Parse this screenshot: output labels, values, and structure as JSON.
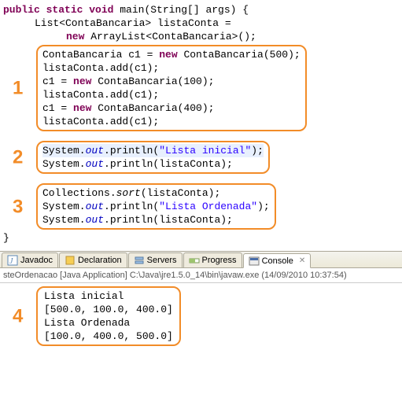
{
  "code": {
    "main_sig_pre": "public static void",
    "main_sig_post": " main(String[] args) {",
    "decl1": "List<ContaBancaria> listaConta =",
    "decl2_pre": "new",
    "decl2_post": " ArrayList<ContaBancaria>();",
    "block1": {
      "num": "1",
      "l1a": "ContaBancaria c1 = ",
      "l1b": "new",
      "l1c": " ContaBancaria(500);",
      "l2": "listaConta.add(c1);",
      "l3a": "c1 = ",
      "l3b": "new",
      "l3c": " ContaBancaria(100);",
      "l4": "listaConta.add(c1);",
      "l5a": "c1 = ",
      "l5b": "new",
      "l5c": " ContaBancaria(400);",
      "l6": "listaConta.add(c1);"
    },
    "block2": {
      "num": "2",
      "l1a": "System.",
      "l1b": "out",
      "l1c": ".println(",
      "l1d": "\"Lista inicial\"",
      "l1e": ");",
      "l2a": "System.",
      "l2b": "out",
      "l2c": ".println(listaConta);"
    },
    "block3": {
      "num": "3",
      "l1a": "Collections.",
      "l1b": "sort",
      "l1c": "(listaConta);",
      "l2a": "System.",
      "l2b": "out",
      "l2c": ".println(",
      "l2d": "\"Lista Ordenada\"",
      "l2e": ");",
      "l3a": "System.",
      "l3b": "out",
      "l3c": ".println(listaConta);"
    },
    "close": "}"
  },
  "tabs": {
    "javadoc": "Javadoc",
    "declaration": "Declaration",
    "servers": "Servers",
    "progress": "Progress",
    "console": "Console"
  },
  "console": {
    "meta": "steOrdenacao [Java Application] C:\\Java\\jre1.5.0_14\\bin\\javaw.exe (14/09/2010 10:37:54)",
    "block4": {
      "num": "4",
      "l1": "Lista inicial",
      "l2": "[500.0, 100.0, 400.0]",
      "l3": "Lista Ordenada",
      "l4": "[100.0, 400.0, 500.0]"
    }
  }
}
